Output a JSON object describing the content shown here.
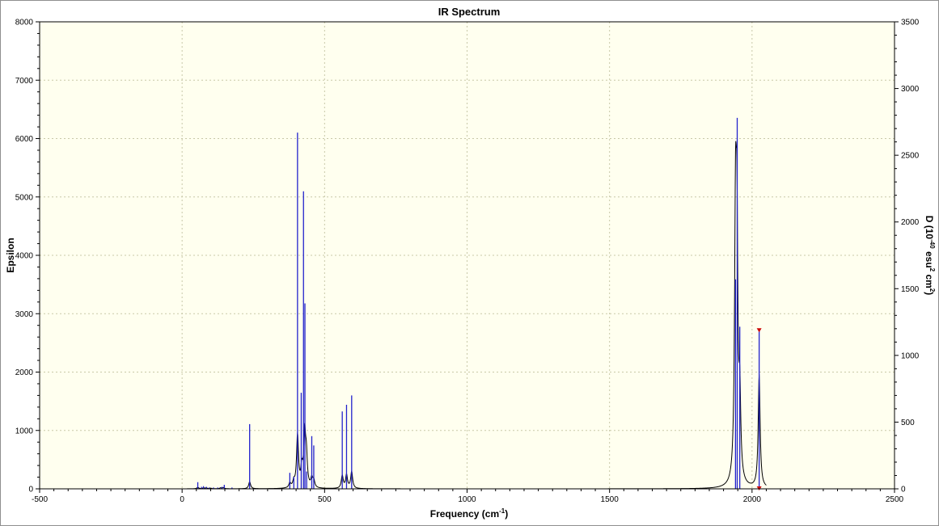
{
  "chart_data": {
    "type": "line",
    "title": "IR Spectrum",
    "xlabel": {
      "main": "Frequency (cm",
      "sup": "-1",
      "close": ")"
    },
    "ylabel": "Epsilon",
    "y2label": {
      "p1": "D (10",
      "sup1": "-40",
      "p2": " esu",
      "sup2": "2",
      "p3": " cm",
      "sup3": "2",
      "p4": ")"
    },
    "xlim": [
      -500,
      2500
    ],
    "ylim": [
      0,
      8000
    ],
    "y2lim": [
      0,
      3500
    ],
    "x_ticks": [
      -500,
      0,
      500,
      1000,
      1500,
      2000,
      2500
    ],
    "y_ticks": [
      0,
      1000,
      2000,
      3000,
      4000,
      5000,
      6000,
      7000,
      8000
    ],
    "y2_ticks": [
      0,
      500,
      1000,
      1500,
      2000,
      2500,
      3000,
      3500
    ],
    "grid": true,
    "colors": {
      "spectrum": "#000000",
      "sticks": "#2222cc",
      "marker": "#cc0000",
      "plot_bg": "#ffffef",
      "grid": "#c8c8a8"
    },
    "series": [
      {
        "name": "Epsilon",
        "axis": "left",
        "style": "lorentzian-line",
        "hwhm": 4,
        "peaks": [
          {
            "x": 55,
            "y": 25
          },
          {
            "x": 75,
            "y": 15
          },
          {
            "x": 85,
            "y": 15
          },
          {
            "x": 100,
            "y": 10
          },
          {
            "x": 135,
            "y": 15
          },
          {
            "x": 145,
            "y": 20
          },
          {
            "x": 237,
            "y": 120
          },
          {
            "x": 378,
            "y": 80
          },
          {
            "x": 392,
            "y": 100
          },
          {
            "x": 405,
            "y": 900
          },
          {
            "x": 420,
            "y": 300
          },
          {
            "x": 430,
            "y": 900
          },
          {
            "x": 436,
            "y": 500
          },
          {
            "x": 455,
            "y": 150
          },
          {
            "x": 462,
            "y": 120
          },
          {
            "x": 562,
            "y": 220
          },
          {
            "x": 577,
            "y": 230
          },
          {
            "x": 595,
            "y": 290
          },
          {
            "x": 1942,
            "y": 4200
          },
          {
            "x": 1947,
            "y": 3800
          },
          {
            "x": 1957,
            "y": 1300
          },
          {
            "x": 2025,
            "y": 1940
          }
        ]
      },
      {
        "name": "D",
        "axis": "right",
        "style": "sticks",
        "x": [
          55,
          68,
          75,
          85,
          95,
          110,
          125,
          140,
          148,
          175,
          237,
          378,
          392,
          405,
          418,
          426,
          431,
          437,
          455,
          462,
          562,
          577,
          595,
          1942,
          1948,
          1957,
          2025
        ],
        "y": [
          50,
          15,
          20,
          15,
          10,
          10,
          10,
          15,
          30,
          10,
          485,
          120,
          90,
          2670,
          720,
          2230,
          1390,
          130,
          395,
          325,
          580,
          630,
          700,
          1570,
          2780,
          1215,
          1185
        ]
      }
    ],
    "annotations": [
      {
        "type": "marker",
        "x": 2025,
        "y2": 1185,
        "shape": "triangle-down"
      },
      {
        "type": "marker",
        "x": 2025,
        "y2": 0,
        "shape": "triangle-down"
      }
    ]
  }
}
